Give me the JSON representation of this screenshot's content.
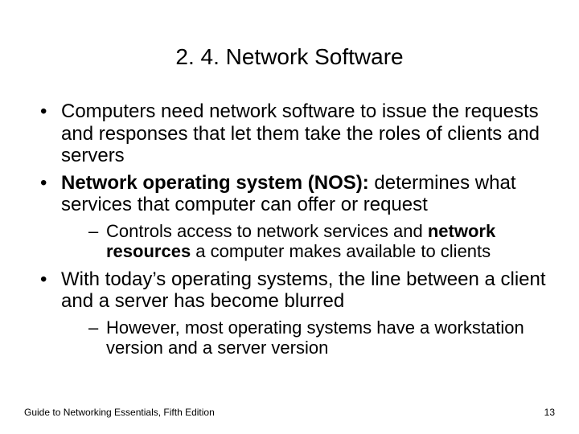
{
  "title": "2. 4. Network Software",
  "bullets": {
    "b1": "Computers need network software to issue the requests and responses that let them take the roles of clients and servers",
    "b2_bold": "Network operating system (NOS): ",
    "b2_rest": "determines what services that computer can offer or request",
    "b2_sub_pre": "Controls access to network services and ",
    "b2_sub_bold": "network resources",
    "b2_sub_post": " a computer makes available to clients",
    "b3": "With today’s operating systems, the line between a client and a server has become blurred",
    "b3_sub": "However, most operating systems have a workstation version and a server version"
  },
  "footer": {
    "left": "Guide to Networking Essentials, Fifth Edition",
    "right": "13"
  }
}
